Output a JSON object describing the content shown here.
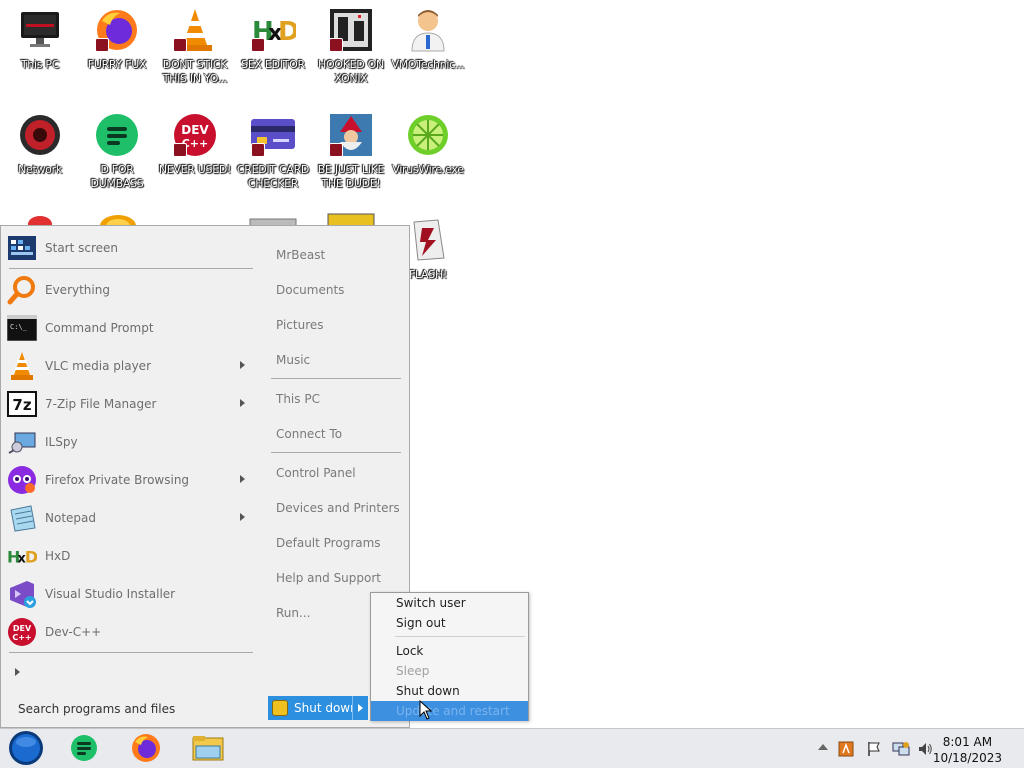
{
  "desktop": {
    "icons": [
      {
        "label": "This PC"
      },
      {
        "label": "FURRY FUX"
      },
      {
        "label": "DONT STICK THIS IN YO..."
      },
      {
        "label": "SEX EDITOR"
      },
      {
        "label": "HOOKED ON XONIX"
      },
      {
        "label": "VMOTechnic..."
      },
      {
        "label": "Network"
      },
      {
        "label": "D FOR DUMBASS"
      },
      {
        "label": "NEVER USED!"
      },
      {
        "label": "CREDIT CARD CHECKER"
      },
      {
        "label": "BE JUST LIKE THE DUDE!"
      },
      {
        "label": "VirusWire.exe"
      },
      {
        "label": "FLASH!"
      }
    ]
  },
  "start_menu": {
    "pinned": [
      {
        "label": "Start screen",
        "icon": "start-screen-icon"
      }
    ],
    "programs": [
      {
        "label": "Everything",
        "icon": "magnifier-icon",
        "submenu": false
      },
      {
        "label": "Command Prompt",
        "icon": "cmd-icon",
        "submenu": false
      },
      {
        "label": "VLC media player",
        "icon": "vlc-cone-icon",
        "submenu": true
      },
      {
        "label": "7-Zip File Manager",
        "icon": "7zip-icon",
        "submenu": true
      },
      {
        "label": "ILSpy",
        "icon": "ilspy-icon",
        "submenu": false
      },
      {
        "label": "Firefox Private Browsing",
        "icon": "firefox-private-icon",
        "submenu": true
      },
      {
        "label": "Notepad",
        "icon": "notepad-icon",
        "submenu": true
      },
      {
        "label": "HxD",
        "icon": "hxd-icon",
        "submenu": false
      },
      {
        "label": "Visual Studio Installer",
        "icon": "vs-installer-icon",
        "submenu": false
      },
      {
        "label": "Dev-C++",
        "icon": "devcpp-icon",
        "submenu": false
      }
    ],
    "search_placeholder": "Search programs and files",
    "right_links": [
      {
        "label": "MrBeast"
      },
      {
        "label": "Documents"
      },
      {
        "label": "Pictures"
      },
      {
        "label": "Music"
      },
      {
        "label": "This PC"
      },
      {
        "label": "Connect To"
      },
      {
        "label": "Control Panel"
      },
      {
        "label": "Devices and Printers"
      },
      {
        "label": "Default Programs"
      },
      {
        "label": "Help and Support"
      },
      {
        "label": "Run..."
      }
    ],
    "shutdown_label": "Shut down"
  },
  "power_menu": {
    "items": [
      {
        "label": "Switch user",
        "state": "normal"
      },
      {
        "label": "Sign out",
        "state": "normal"
      },
      {
        "label": "Lock",
        "state": "normal"
      },
      {
        "label": "Sleep",
        "state": "disabled"
      },
      {
        "label": "Shut down",
        "state": "normal"
      },
      {
        "label": "Update and restart",
        "state": "highlighted"
      }
    ]
  },
  "taskbar": {
    "clock_time": "8:01 AM",
    "clock_date": "10/18/2023",
    "apps": [
      "start-orb-icon",
      "notes-app-icon",
      "firefox-icon",
      "file-explorer-icon"
    ]
  },
  "colors": {
    "highlight": "#2d8fe0",
    "menu_bg": "#f0f0f0",
    "taskbar_bg": "#e9eaed"
  }
}
